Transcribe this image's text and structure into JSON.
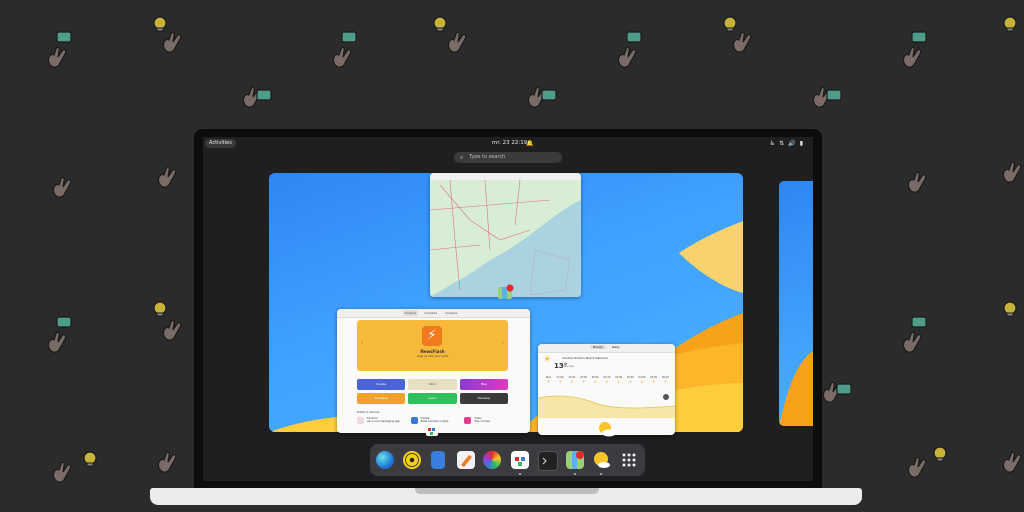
{
  "topbar": {
    "activities": "Activities",
    "clock": "mr. 23  22:19",
    "bell_icon": "bell-icon",
    "tray_icons": [
      "accessibility-icon",
      "network-icon",
      "volume-icon",
      "battery-icon"
    ]
  },
  "search": {
    "placeholder": "Type to search"
  },
  "store": {
    "tabs": [
      "Explore",
      "Installed",
      "Updates"
    ],
    "featured": {
      "name": "NewsFlash",
      "description": "Keep up with your feeds"
    },
    "categories": [
      {
        "label": "Create",
        "color": "#4a63d8"
      },
      {
        "label": "Work",
        "color": "#e8dfc3"
      },
      {
        "label": "Play",
        "color": "#c23ac9"
      },
      {
        "label": "Socialize",
        "color": "#f1a22b"
      },
      {
        "label": "Learn",
        "color": "#2fbf5b"
      },
      {
        "label": "Develop",
        "color": "#3b3b3b"
      }
    ],
    "section_title": "Editor's Choice",
    "apps": [
      {
        "name": "Ferdium",
        "desc": "All-in-one messaging app"
      },
      {
        "name": "Foliate",
        "desc": "Read e-books in style"
      },
      {
        "name": "Video",
        "desc": "Play movies"
      }
    ]
  },
  "weather": {
    "tabs": [
      "Hourly",
      "Daily"
    ],
    "temperature": "13°",
    "location": "Central Ontario Brant Oakland",
    "condition": "Clear sky",
    "hours": [
      "Now",
      "21:00",
      "22:00",
      "23:00",
      "00:00",
      "01:00",
      "02:00",
      "03:00",
      "04:00",
      "05:00",
      "06:00"
    ]
  },
  "dock": {
    "apps": [
      "web-browser-icon",
      "rhythmbox-icon",
      "files-icon",
      "text-editor-icon",
      "color-wheel-icon",
      "software-icon",
      "terminal-icon",
      "maps-icon",
      "weather-icon",
      "app-grid-icon"
    ]
  }
}
